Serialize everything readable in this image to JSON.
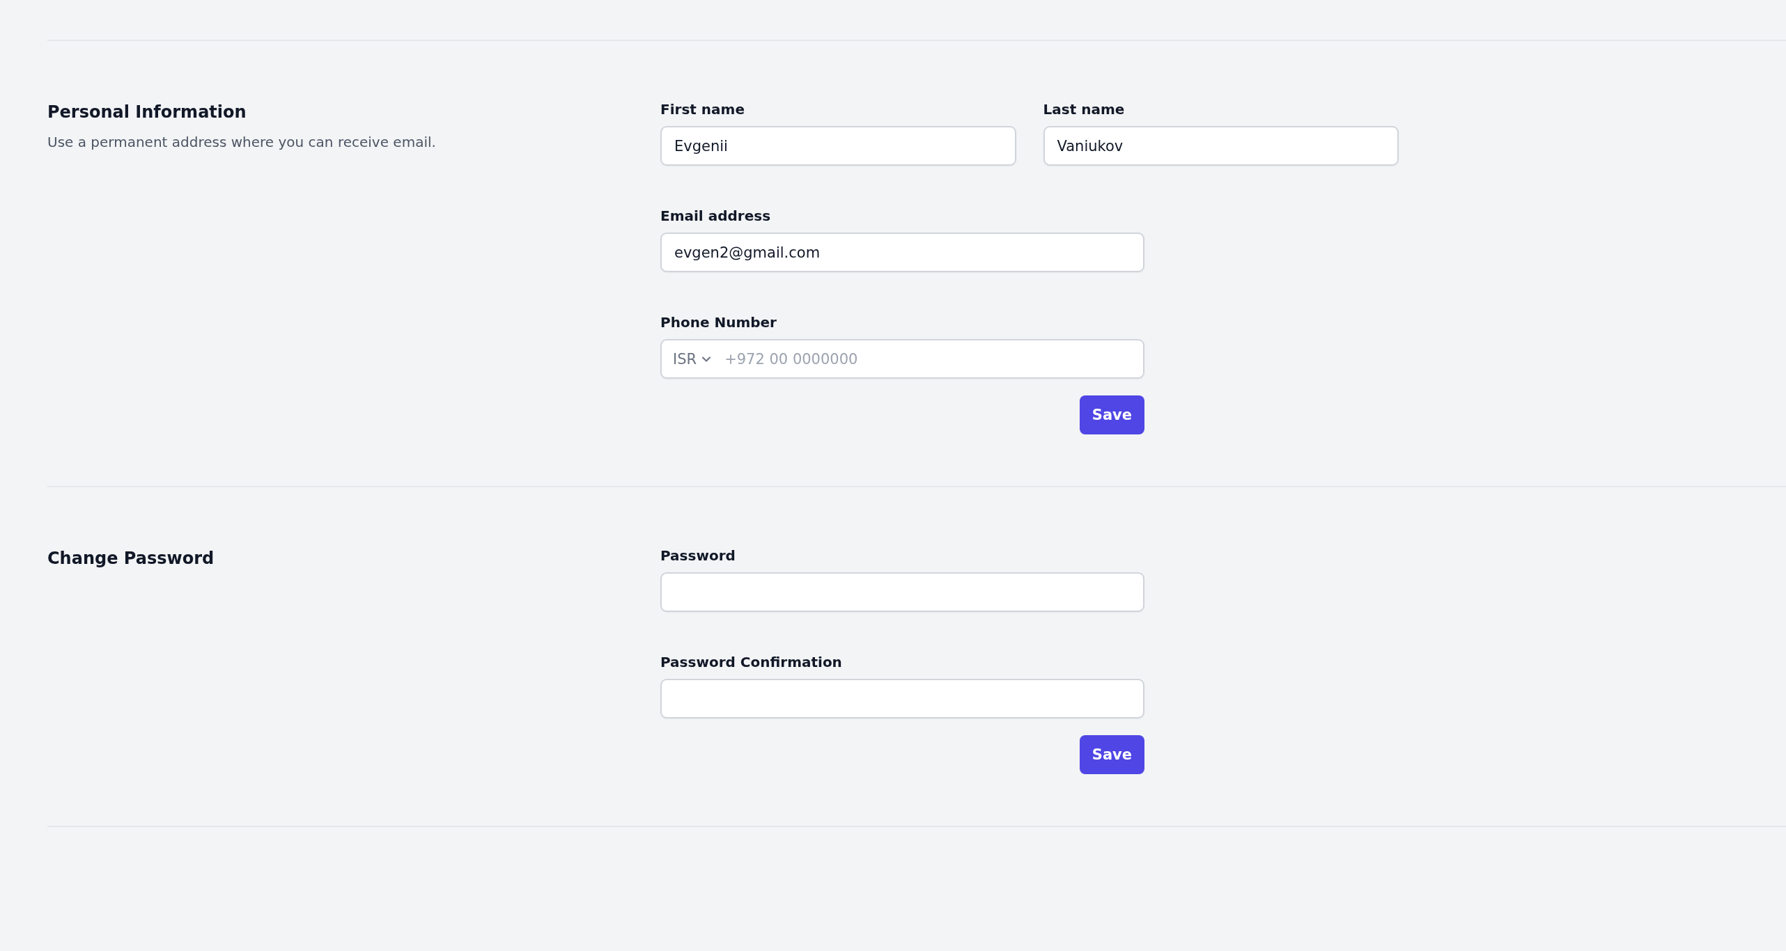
{
  "sections": [
    {
      "title": "Personal Information",
      "description": "Use a permanent address where you can receive email.",
      "rows": [
        {
          "fields": [
            {
              "kind": "text",
              "label": "First name",
              "value": "Evgenii"
            },
            {
              "kind": "text",
              "label": "Last name",
              "value": "Vaniukov"
            }
          ]
        },
        {
          "fields": [
            {
              "kind": "text",
              "label": "Email address",
              "value": "evgen2@gmail.com"
            }
          ]
        },
        {
          "fields": [
            {
              "kind": "phone",
              "label": "Phone Number",
              "country": "ISR",
              "placeholder": "+972 00 0000000"
            }
          ]
        }
      ],
      "button": "Save"
    },
    {
      "title": "Change Password",
      "rows": [
        {
          "fields": [
            {
              "kind": "password",
              "label": "Password"
            }
          ]
        },
        {
          "fields": [
            {
              "kind": "password",
              "label": "Password Confirmation"
            }
          ]
        }
      ],
      "button": "Save"
    }
  ]
}
